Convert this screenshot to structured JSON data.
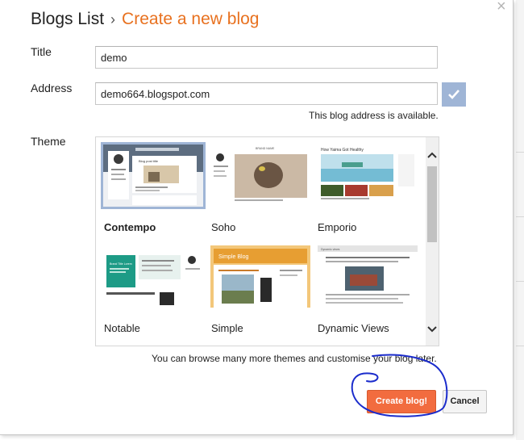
{
  "header": {
    "breadcrumb_root": "Blogs List",
    "separator": "›",
    "current": "Create a new blog"
  },
  "form": {
    "title_label": "Title",
    "title_value": "demo",
    "address_label": "Address",
    "address_value": "demo664.blogspot.com",
    "availability": "This blog address is available.",
    "theme_label": "Theme"
  },
  "themes": [
    {
      "name": "Contempo",
      "selected": true,
      "preview_title": "Blog post title"
    },
    {
      "name": "Soho",
      "selected": false,
      "preview_title": "BRAND NAME"
    },
    {
      "name": "Emporio",
      "selected": false,
      "preview_title": "How Yaima Got Healthy"
    },
    {
      "name": "Notable",
      "selected": false,
      "preview_title": "Brand Title Lorem"
    },
    {
      "name": "Simple",
      "selected": false,
      "preview_title": "Simple Blog"
    },
    {
      "name": "Dynamic Views",
      "selected": false,
      "preview_title": "Dynamic views"
    }
  ],
  "browse_text": "You can browse many more themes and customise your blog later.",
  "buttons": {
    "create": "Create blog!",
    "cancel": "Cancel"
  },
  "icons": {
    "close": "close-icon",
    "check": "checkmark-icon",
    "scroll_up": "chevron-up-icon",
    "scroll_down": "chevron-down-icon"
  },
  "colors": {
    "accent": "#e8711f",
    "create_button": "#f26c3f",
    "check_box": "#9fb5d6",
    "selection": "#9fb5d6",
    "annotation_ink": "#1b2ccc"
  }
}
